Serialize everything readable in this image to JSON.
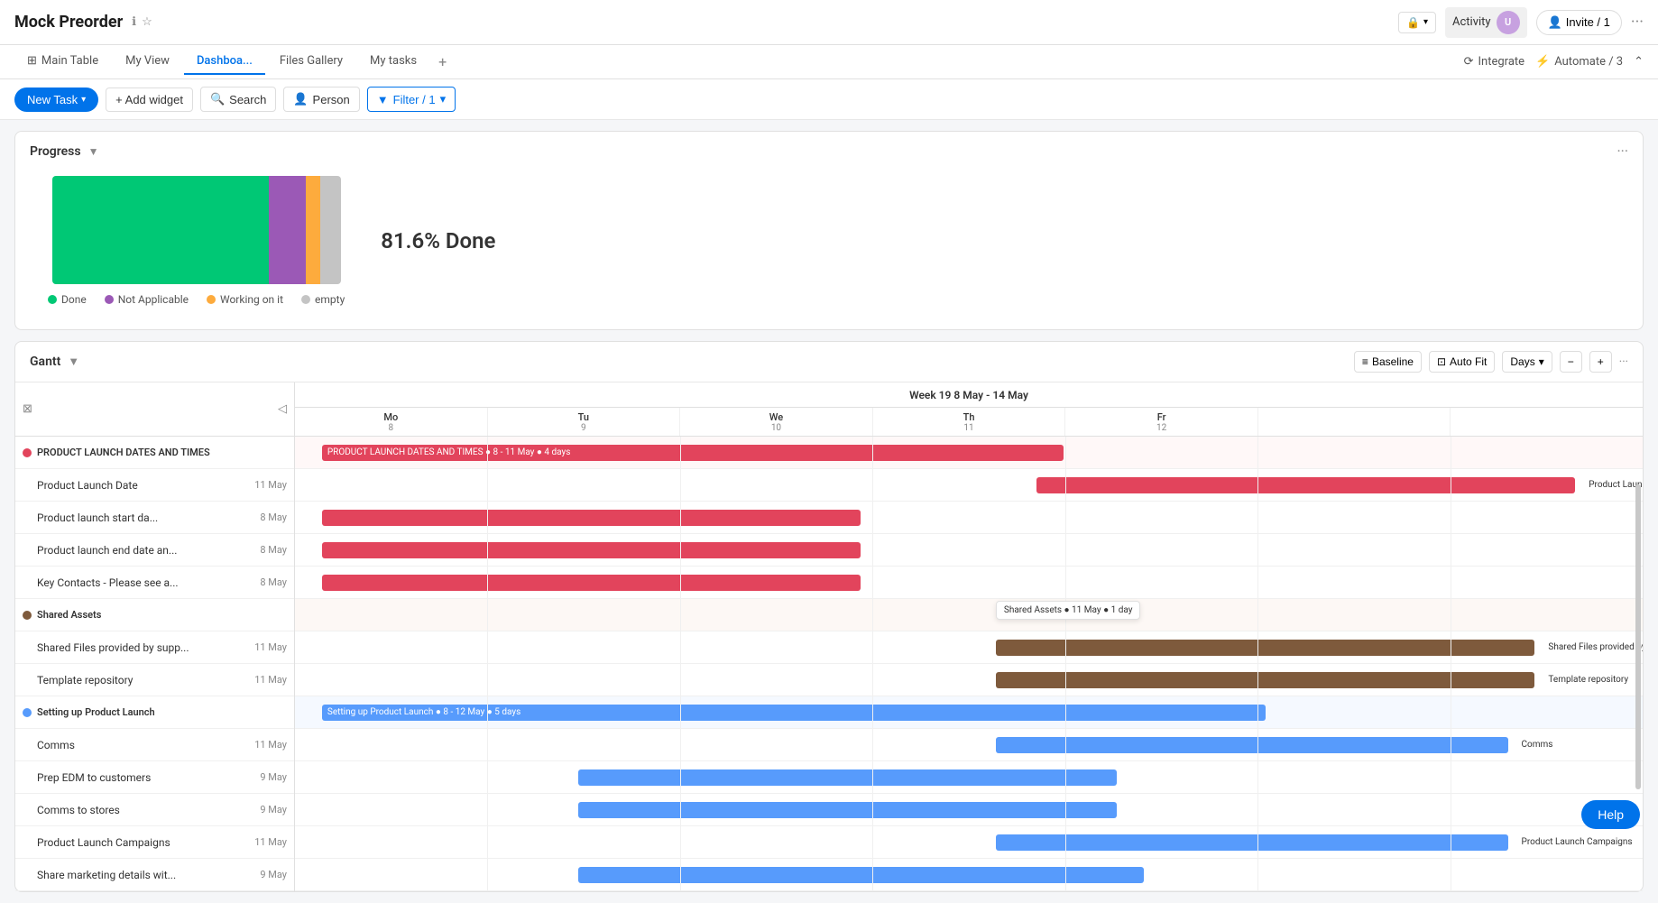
{
  "app": {
    "title": "Mock Preorder",
    "info_icon": "ℹ",
    "star_icon": "☆"
  },
  "topbar": {
    "lock_label": "🔒",
    "activity_label": "Activity",
    "avatar_initials": "U",
    "invite_label": "Invite / 1",
    "more_icon": "···"
  },
  "tabs": [
    {
      "label": "Main Table",
      "icon": "⊞",
      "active": false
    },
    {
      "label": "My View",
      "active": false
    },
    {
      "label": "Dashboa...",
      "active": true
    },
    {
      "label": "Files Gallery",
      "active": false
    },
    {
      "label": "My tasks",
      "active": false
    }
  ],
  "tabs_right": {
    "integrate_label": "Integrate",
    "automate_label": "Automate / 3",
    "collapse_icon": "⌃"
  },
  "toolbar": {
    "new_task_label": "New Task",
    "add_widget_label": "+ Add widget",
    "search_label": "Search",
    "person_label": "Person",
    "filter_label": "Filter / 1"
  },
  "progress_widget": {
    "title": "Progress",
    "percent_done": "81.6% Done",
    "segments": [
      {
        "label": "Done",
        "color": "#00c875",
        "width": 75
      },
      {
        "label": "Not Applicable",
        "color": "#9b59b6",
        "width": 13
      },
      {
        "label": "Working on it",
        "color": "#fdab3d",
        "width": 5
      },
      {
        "label": "empty",
        "color": "#c4c4c4",
        "width": 7
      }
    ],
    "legend": [
      {
        "label": "Done",
        "color": "#00c875"
      },
      {
        "label": "Not Applicable",
        "color": "#9b59b6"
      },
      {
        "label": "Working on it",
        "color": "#fdab3d"
      },
      {
        "label": "empty",
        "color": "#c4c4c4"
      }
    ]
  },
  "gantt_widget": {
    "title": "Gantt",
    "baseline_label": "Baseline",
    "autofit_label": "Auto Fit",
    "days_label": "Days",
    "week_label": "Week 19  8 May - 14 May",
    "days": [
      {
        "name": "Mo",
        "num": "8"
      },
      {
        "name": "Tu",
        "num": "9"
      },
      {
        "name": "We",
        "num": "10"
      },
      {
        "name": "Th",
        "num": "11"
      },
      {
        "name": "Fr",
        "num": "12"
      }
    ],
    "groups": [
      {
        "name": "PRODUCT LAUNCH DATES AND TIMES",
        "color": "#e2445c",
        "items": [
          {
            "label": "Product Launch Date",
            "date": "11 May"
          },
          {
            "label": "Product launch start da...",
            "date": "8 May"
          },
          {
            "label": "Product launch end date an...",
            "date": "8 May"
          },
          {
            "label": "Key Contacts - Please see a...",
            "date": "8 May"
          }
        ]
      },
      {
        "name": "Shared Assets",
        "color": "#7e5a3c",
        "items": [
          {
            "label": "Shared Files provided by supp...",
            "date": "11 May"
          },
          {
            "label": "Template repository",
            "date": "11 May"
          }
        ]
      },
      {
        "name": "Setting up Product Launch",
        "color": "#579bfc",
        "items": [
          {
            "label": "Comms",
            "date": "11 May"
          },
          {
            "label": "Prep EDM to customers",
            "date": "9 May"
          },
          {
            "label": "Comms to stores",
            "date": "9 May"
          },
          {
            "label": "Product Launch Campaigns",
            "date": "11 May"
          },
          {
            "label": "Share marketing details wit...",
            "date": "9 May"
          }
        ]
      }
    ],
    "bars": {
      "group1_bar": {
        "label": "PRODUCT LAUNCH DATES AND TIMES ● 8 - 11 May ● 4 days",
        "color": "#e2445c"
      },
      "shared_assets_tooltip": "Shared Assets ● 11 May ● 1 day",
      "setting_bar": {
        "label": "Setting up Product Launch ● 8 - 12 May ● 5 days",
        "color": "#579bfc"
      },
      "product_launch_date_label": "Product Launch Date",
      "shared_files_label": "Shared Files provided by supplier",
      "template_repo_label": "Template repository",
      "comms_label": "Comms",
      "product_launch_campaigns_label": "Product Launch Campaigns"
    }
  },
  "help_btn": "Help"
}
